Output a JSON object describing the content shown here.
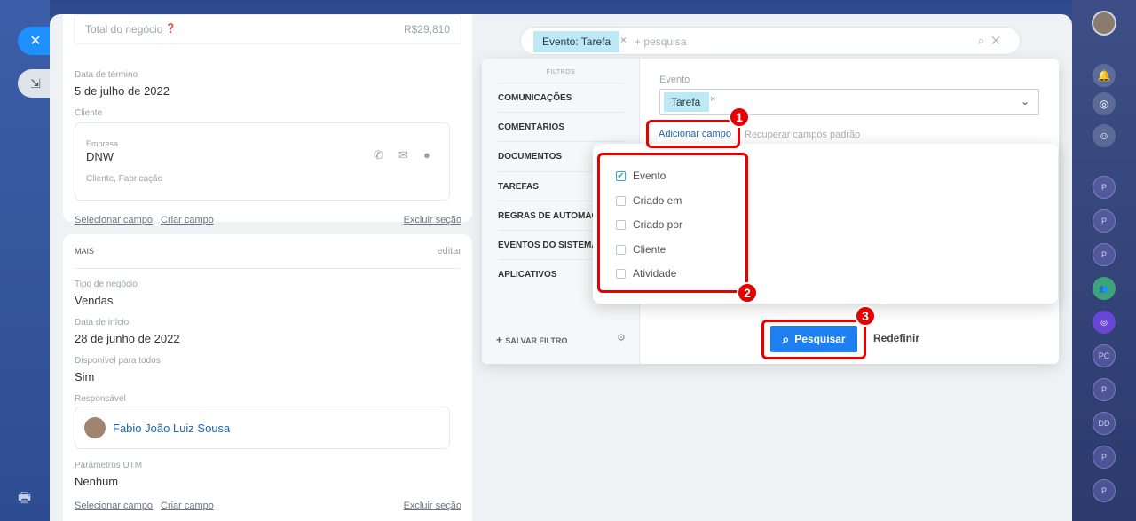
{
  "deal": {
    "total_label": "Total do negócio",
    "total_value": "R$29,810",
    "end_date_label": "Data de término",
    "end_date_value": "5 de julho de 2022",
    "client_label": "Cliente",
    "company_label": "Empresa",
    "company_name": "DNW",
    "company_sub": "Cliente, Fabricação",
    "select_field": "Selecionar campo",
    "create_field": "Criar campo",
    "delete_section": "Excluir seção"
  },
  "more": {
    "title": "MAIS",
    "edit": "editar",
    "deal_type_label": "Tipo de negócio",
    "deal_type_value": "Vendas",
    "start_date_label": "Data de início",
    "start_date_value": "28 de junho de 2022",
    "available_label": "Disponível para todos",
    "available_value": "Sim",
    "responsible_label": "Responsável",
    "responsible_name": "Fabio João Luiz Sousa",
    "utm_label": "Parâmetros UTM",
    "utm_value": "Nenhum",
    "select_field": "Selecionar campo",
    "create_field": "Criar campo",
    "delete_section": "Excluir seção"
  },
  "search": {
    "chip": "Evento: Tarefa",
    "chip_close": "×",
    "placeholder": "+ pesquisa"
  },
  "filters": {
    "title": "FILTROS",
    "items": [
      "COMUNICAÇÕES",
      "COMENTÁRIOS",
      "DOCUMENTOS",
      "TAREFAS",
      "REGRAS DE AUTOMAÇÃO",
      "EVENTOS DO SISTEMA",
      "APLICATIVOS"
    ],
    "save_filter": "SALVAR FILTRO"
  },
  "event_field": {
    "label": "Evento",
    "chip": "Tarefa",
    "add_field": "Adicionar campo",
    "restore": "Recuperar campos padrão"
  },
  "field_options": [
    {
      "label": "Evento",
      "checked": true
    },
    {
      "label": "Criado em",
      "checked": false
    },
    {
      "label": "Criado por",
      "checked": false
    },
    {
      "label": "Cliente",
      "checked": false
    },
    {
      "label": "Atividade",
      "checked": false
    }
  ],
  "actions": {
    "search": "Pesquisar",
    "reset": "Redefinir"
  },
  "badges": [
    "1",
    "2",
    "3"
  ],
  "right_sidebar": [
    "P",
    "P",
    "P",
    "P",
    "PC",
    "P",
    "DD",
    "P",
    "P"
  ],
  "colors": {
    "accent": "#1e7ff0",
    "highlight": "#e60000",
    "chip": "#bde8f6"
  }
}
